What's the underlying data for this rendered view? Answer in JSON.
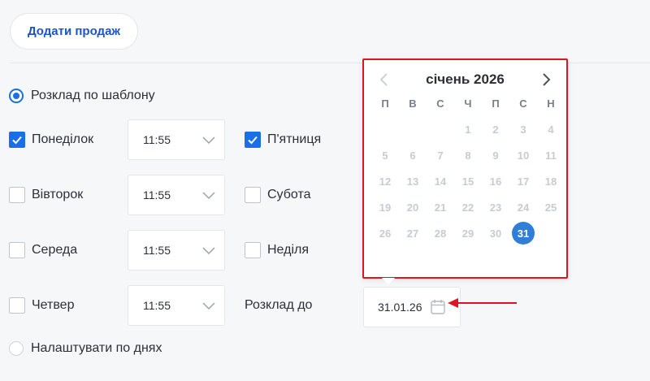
{
  "toolbar": {
    "add_sale_label": "Додати продаж"
  },
  "schedule": {
    "template_option": "Розклад по шаблону",
    "by_days_option": "Налаштувати по днях",
    "days": [
      {
        "label": "Понеділок",
        "checked": true,
        "time": "11:55"
      },
      {
        "label": "Вівторок",
        "checked": false,
        "time": "11:55"
      },
      {
        "label": "Середа",
        "checked": false,
        "time": "11:55"
      },
      {
        "label": "Четвер",
        "checked": false,
        "time": "11:55"
      },
      {
        "label": "П'ятниця",
        "checked": true
      },
      {
        "label": "Субота",
        "checked": false
      },
      {
        "label": "Неділя",
        "checked": false
      }
    ],
    "until_label": "Розклад до",
    "until_value": "31.01.26"
  },
  "calendar": {
    "title": "січень 2026",
    "weekdays": [
      "П",
      "В",
      "С",
      "Ч",
      "П",
      "С",
      "Н"
    ],
    "weeks": [
      [
        "",
        "",
        "",
        "1",
        "2",
        "3",
        "4"
      ],
      [
        "5",
        "6",
        "7",
        "8",
        "9",
        "10",
        "11"
      ],
      [
        "12",
        "13",
        "14",
        "15",
        "16",
        "17",
        "18"
      ],
      [
        "19",
        "20",
        "21",
        "22",
        "23",
        "24",
        "25"
      ],
      [
        "26",
        "27",
        "28",
        "29",
        "30",
        "31",
        ""
      ]
    ],
    "selected": "31"
  },
  "colors": {
    "accent": "#1a6ee8",
    "highlight_border": "#e0141f",
    "selected_day": "#2f7fd9"
  },
  "icons": {
    "prev": "chevron-left-icon",
    "next": "chevron-right-icon",
    "field": "calendar-icon",
    "dropdown": "chevron-down-icon"
  }
}
